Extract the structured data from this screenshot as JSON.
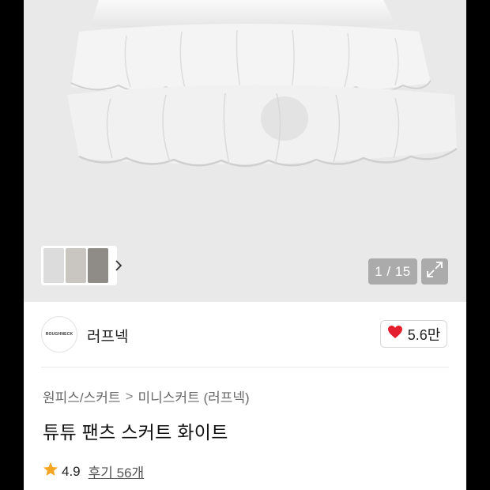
{
  "gallery": {
    "counter": "1 / 15",
    "thumbnail_colors": [
      "#dcdcdc",
      "#c9c6c2",
      "#8f8c88"
    ]
  },
  "shop": {
    "logo_text": "ROUGHNECK",
    "name": "러프넥",
    "likes": "5.6만"
  },
  "product": {
    "category_main": "원피스/스커트",
    "category_separator": ">",
    "category_sub": "미니스커트 (러프넥)",
    "title": "튜튜 팬츠 스커트 화이트",
    "rating": "4.9",
    "reviews_label": "후기 56개"
  },
  "colors": {
    "heart": "#e5202e",
    "star": "#f5a623",
    "hero_bg": "#e9e9e9"
  }
}
